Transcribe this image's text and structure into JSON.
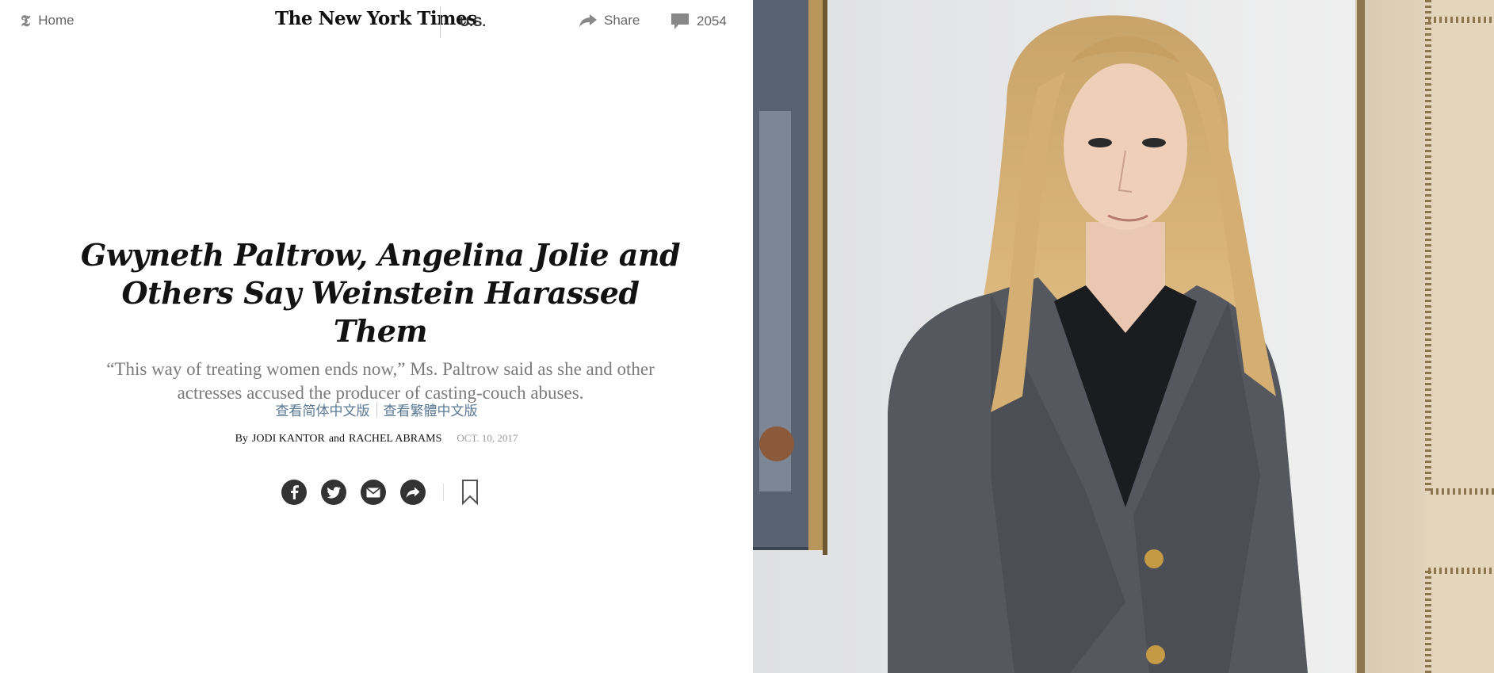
{
  "header": {
    "home_label": "Home",
    "masthead": "The New York Times",
    "section": "U.S.",
    "share_label": "Share",
    "comment_count": "2054"
  },
  "article": {
    "headline": "Gwyneth Paltrow, Angelina Jolie and Others Say Weinstein Harassed Them",
    "summary": "“This way of treating women ends now,” Ms. Paltrow said as she and other actresses accused the producer of casting-couch abuses.",
    "translations": [
      "查看简体中文版",
      "查看繁體中文版"
    ],
    "byline_prefix": "By",
    "author_1": "JODI KANTOR",
    "byline_and": "and",
    "author_2": "RACHEL ABRAMS",
    "date": "OCT. 10, 2017"
  },
  "share_tools": [
    "facebook-icon",
    "twitter-icon",
    "email-icon",
    "share-icon",
    "bookmark-icon"
  ],
  "colors": {
    "background": "#ffffff",
    "text": "#121212",
    "muted": "#7b7b7b",
    "link": "#5a7894",
    "icon_fill": "#333333"
  }
}
